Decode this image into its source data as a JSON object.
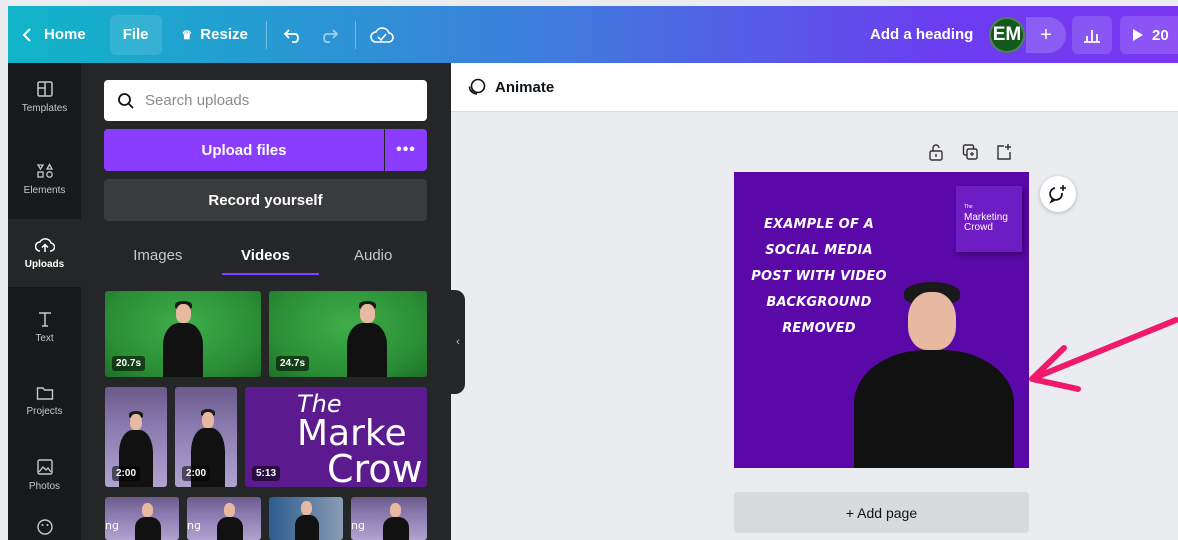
{
  "topbar": {
    "home_label": "Home",
    "file_label": "File",
    "resize_label": "Resize",
    "heading_label": "Add a heading",
    "avatar_initials": "EM",
    "plus_label": "+",
    "present_label": "20"
  },
  "rail": {
    "items": [
      {
        "label": "Templates",
        "icon": "templates-icon"
      },
      {
        "label": "Elements",
        "icon": "elements-icon"
      },
      {
        "label": "Uploads",
        "icon": "uploads-icon"
      },
      {
        "label": "Text",
        "icon": "text-icon"
      },
      {
        "label": "Projects",
        "icon": "projects-icon"
      },
      {
        "label": "Photos",
        "icon": "photos-icon"
      }
    ]
  },
  "panel": {
    "search_placeholder": "Search uploads",
    "upload_label": "Upload files",
    "more_label": "•••",
    "record_label": "Record yourself",
    "tabs": [
      "Images",
      "Videos",
      "Audio"
    ],
    "active_tab": "Videos",
    "videos": [
      {
        "duration": "20.7s"
      },
      {
        "duration": "24.7s"
      },
      {
        "duration": "2:00"
      },
      {
        "duration": "2:00"
      },
      {
        "duration": "5:13"
      }
    ],
    "brand_thumb_text": [
      "The",
      "Marke",
      "Crow"
    ],
    "partial_row_text": [
      "ng",
      "ng",
      "ng"
    ]
  },
  "canvas": {
    "animate_label": "Animate",
    "design_title_lines": [
      "EXAMPLE OF A",
      "SOCIAL MEDIA",
      "POST WITH VIDEO",
      "BACKGROUND",
      "REMOVED"
    ],
    "logo_small": "The",
    "logo_lines": [
      "Marketing",
      "Crowd"
    ],
    "add_page_label": "+ Add page"
  },
  "colors": {
    "accent": "#8b3dff",
    "design_bg": "#5a08a8",
    "arrow": "#f0196b"
  }
}
